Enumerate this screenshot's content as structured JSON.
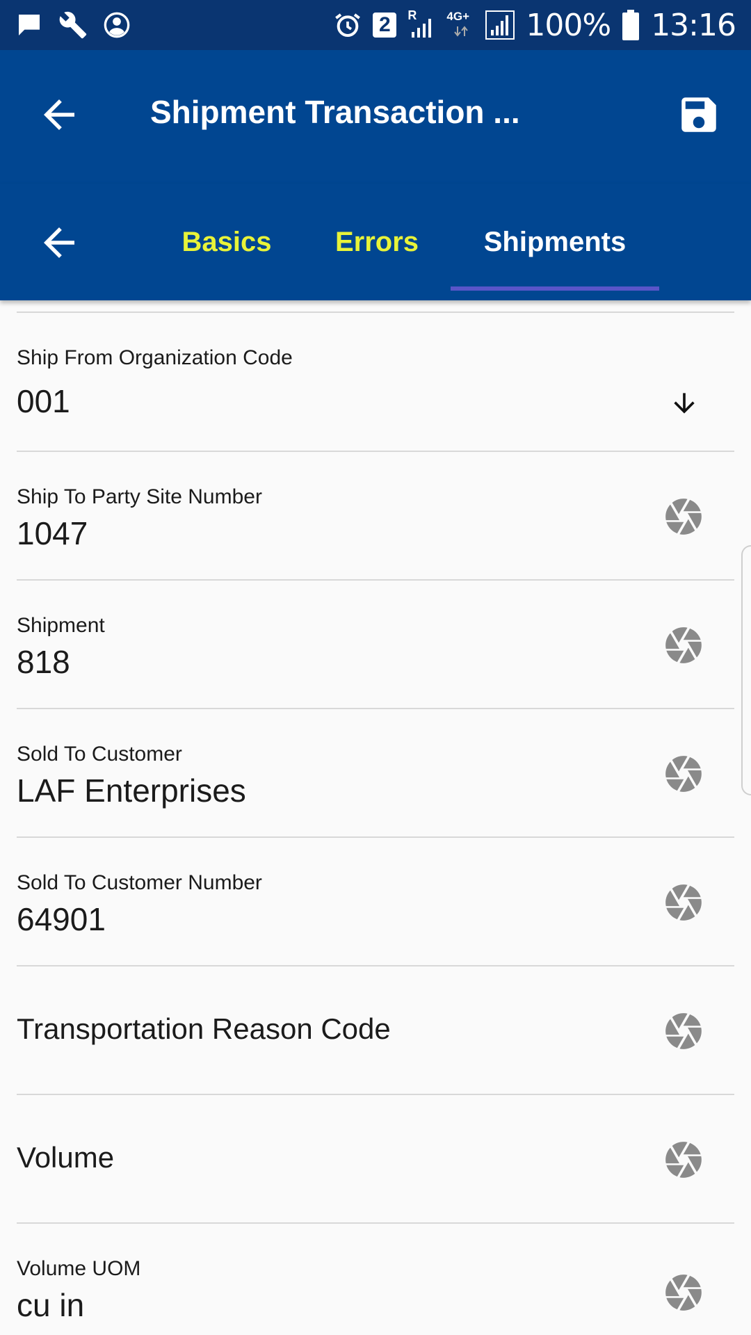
{
  "status_bar": {
    "sim_badge": "2",
    "roaming": "R",
    "network": "4G+",
    "battery": "100%",
    "time": "13:16",
    "icons": [
      "message-icon",
      "wrench-icon",
      "account-circle-icon",
      "alarm-icon",
      "sim-badge-icon",
      "signal-icon",
      "network-4g-icon",
      "signal-icon",
      "battery-icon"
    ]
  },
  "app_bar": {
    "title": "Shipment Transaction ...",
    "back_icon": "arrow-back-icon",
    "save_icon": "save-icon"
  },
  "tabs": {
    "back_icon": "arrow-back-icon",
    "items": [
      {
        "label": "Basics",
        "selected": false
      },
      {
        "label": "Errors",
        "selected": false
      },
      {
        "label": "Shipments",
        "selected": true
      }
    ],
    "active_color": "#ffffff",
    "inactive_color": "#e8f339",
    "indicator_color": "#5a55c9"
  },
  "fields": [
    {
      "label": "Ship From Organization Code",
      "value": "001",
      "icon": "arrow-down-icon"
    },
    {
      "label": "Ship To Party Site Number",
      "value": "1047",
      "icon": "aperture-icon"
    },
    {
      "label": "Shipment",
      "value": "818",
      "icon": "aperture-icon"
    },
    {
      "label": "Sold To Customer",
      "value": "LAF Enterprises",
      "icon": "aperture-icon"
    },
    {
      "label": "Sold To Customer Number",
      "value": "64901",
      "icon": "aperture-icon"
    },
    {
      "label": "Transportation Reason Code",
      "value": "",
      "icon": "aperture-icon"
    },
    {
      "label": "Volume",
      "value": "",
      "icon": "aperture-icon"
    },
    {
      "label": "Volume UOM",
      "value": "cu in",
      "icon": "aperture-icon"
    }
  ],
  "colors": {
    "status_bar": "#0a3571",
    "app_bar": "#014691",
    "background": "#fafafa",
    "icon_gray": "#8a8a8a"
  }
}
